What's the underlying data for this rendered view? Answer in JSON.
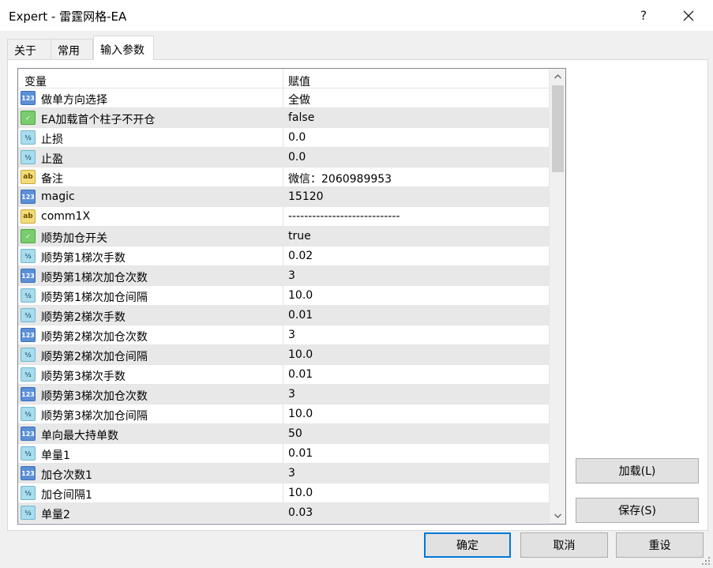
{
  "window": {
    "title": "Expert - 雷霆网格-EA",
    "help_label": "?"
  },
  "tabs": [
    {
      "label": "关于"
    },
    {
      "label": "常用"
    },
    {
      "label": "输入参数"
    }
  ],
  "grid": {
    "headers": {
      "variable": "变量",
      "value": "赋值"
    },
    "rows": [
      {
        "type": "int",
        "icon": "123",
        "name": "做单方向选择",
        "value": "全做"
      },
      {
        "type": "bool",
        "icon": "✓",
        "name": "EA加载首个柱子不开仓",
        "value": "false"
      },
      {
        "type": "dbl",
        "icon": "½",
        "name": "止损",
        "value": "0.0"
      },
      {
        "type": "dbl",
        "icon": "½",
        "name": "止盈",
        "value": "0.0"
      },
      {
        "type": "str",
        "icon": "ab",
        "name": "备注",
        "value": "微信：2060989953"
      },
      {
        "type": "int",
        "icon": "123",
        "name": "magic",
        "value": "15120"
      },
      {
        "type": "str",
        "icon": "ab",
        "name": "comm1X",
        "value": "----------------------------"
      },
      {
        "type": "bool",
        "icon": "✓",
        "name": "顺势加仓开关",
        "value": "true"
      },
      {
        "type": "dbl",
        "icon": "½",
        "name": "顺势第1梯次手数",
        "value": "0.02"
      },
      {
        "type": "int",
        "icon": "123",
        "name": "顺势第1梯次加仓次数",
        "value": "3"
      },
      {
        "type": "dbl",
        "icon": "½",
        "name": "顺势第1梯次加仓间隔",
        "value": "10.0"
      },
      {
        "type": "dbl",
        "icon": "½",
        "name": "顺势第2梯次手数",
        "value": "0.01"
      },
      {
        "type": "int",
        "icon": "123",
        "name": "顺势第2梯次加仓次数",
        "value": "3"
      },
      {
        "type": "dbl",
        "icon": "½",
        "name": "顺势第2梯次加仓间隔",
        "value": "10.0"
      },
      {
        "type": "dbl",
        "icon": "½",
        "name": "顺势第3梯次手数",
        "value": "0.01"
      },
      {
        "type": "int",
        "icon": "123",
        "name": "顺势第3梯次加仓次数",
        "value": "3"
      },
      {
        "type": "dbl",
        "icon": "½",
        "name": "顺势第3梯次加仓间隔",
        "value": "10.0"
      },
      {
        "type": "int",
        "icon": "123",
        "name": "单向最大持单数",
        "value": "50"
      },
      {
        "type": "dbl",
        "icon": "½",
        "name": "单量1",
        "value": "0.01"
      },
      {
        "type": "int",
        "icon": "123",
        "name": "加仓次数1",
        "value": "3"
      },
      {
        "type": "dbl",
        "icon": "½",
        "name": "加仓间隔1",
        "value": "10.0"
      },
      {
        "type": "dbl",
        "icon": "½",
        "name": "单量2",
        "value": "0.03"
      }
    ]
  },
  "buttons": {
    "load": "加载(L)",
    "save": "保存(S)",
    "ok": "确定",
    "cancel": "取消",
    "reset": "重设"
  },
  "colors": {
    "accent": "#0078d7",
    "row_alt": "#e8e8e8"
  }
}
